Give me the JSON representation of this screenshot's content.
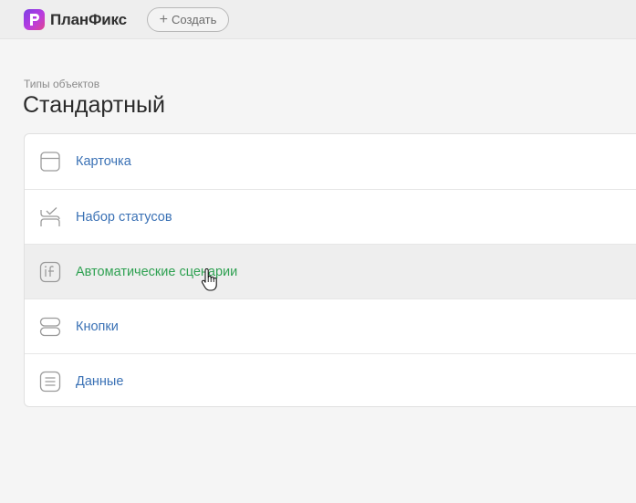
{
  "app": {
    "name": "ПланФикс",
    "logo_letter": "P",
    "brand_color": "#8a3fe0"
  },
  "header": {
    "create_label": "Создать",
    "create_icon": "plus-icon"
  },
  "breadcrumb": "Типы объектов",
  "page_title": "Стандартный",
  "items": [
    {
      "label": "Карточка",
      "icon": "card-icon"
    },
    {
      "label": "Набор статусов",
      "icon": "status-set-icon"
    },
    {
      "label": "Автоматические сценарии",
      "icon": "scenario-function-icon",
      "hovered": true
    },
    {
      "label": "Кнопки",
      "icon": "buttons-icon"
    },
    {
      "label": "Данные",
      "icon": "data-list-icon"
    }
  ],
  "colors": {
    "link": "#3a71b5",
    "link_hover": "#2fa152",
    "icon_stroke": "#9a9a9a"
  }
}
